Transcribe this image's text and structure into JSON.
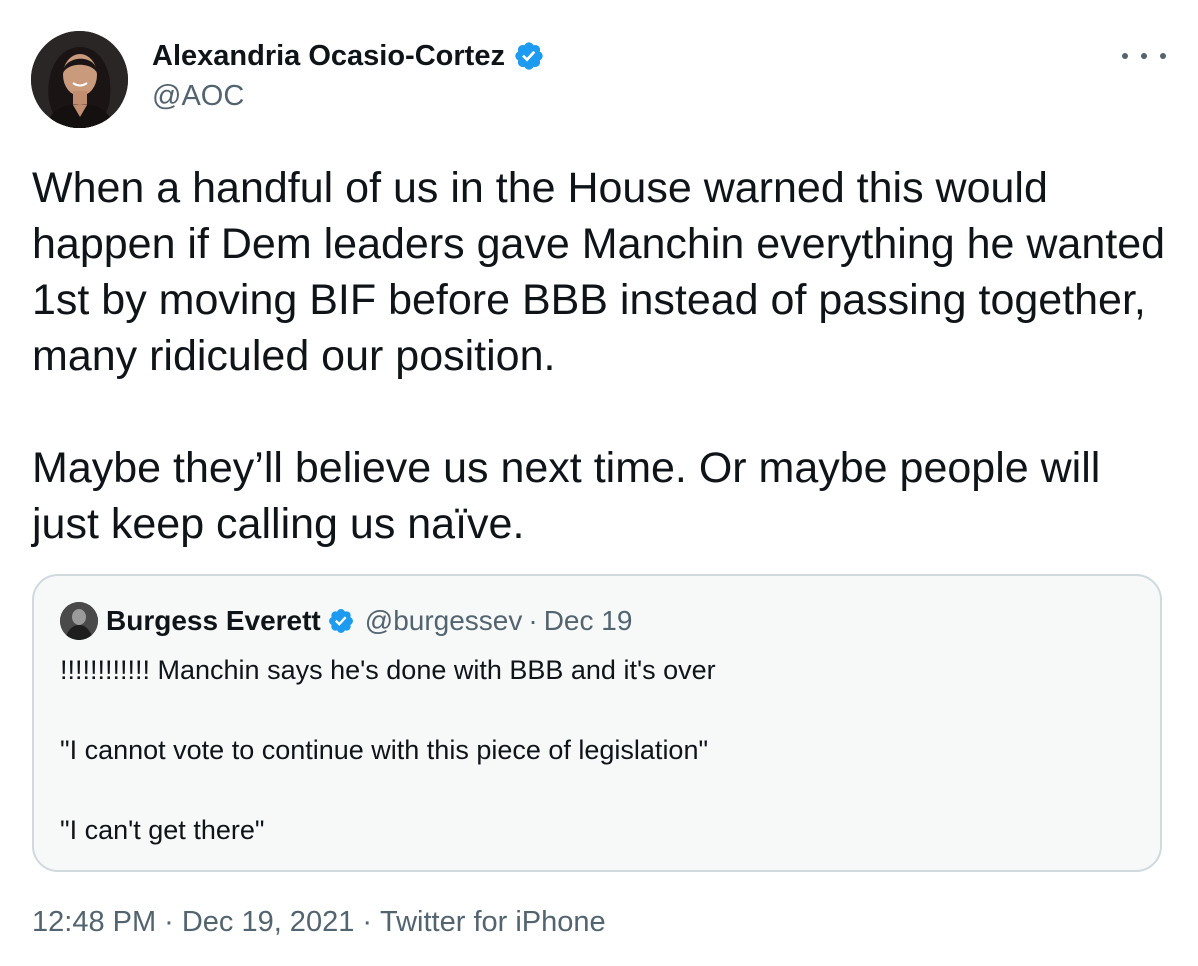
{
  "author": {
    "name": "Alexandria Ocasio-Cortez",
    "handle": "@AOC",
    "verified": true
  },
  "tweet": {
    "paragraph1": "When a handful of us in the House warned this would happen if Dem leaders gave Manchin everything he wanted 1st by moving BIF before BBB instead of passing together, many ridiculed our position.",
    "paragraph2": "Maybe they’ll believe us next time. Or maybe people will just keep calling us naïve."
  },
  "quoted": {
    "name": "Burgess Everett",
    "handle": "@burgessev",
    "separator": "·",
    "date": "Dec 19",
    "verified": true,
    "line1": "!!!!!!!!!!!! Manchin says he's done with BBB and it's over",
    "line2": "\"I cannot vote to continue with this piece of legislation\"",
    "line3": "\"I can't get there\""
  },
  "meta": {
    "time": "12:48 PM",
    "separator": "·",
    "date": "Dec 19, 2021",
    "source": "Twitter for iPhone"
  },
  "icons": {
    "verified": "verified-badge-icon",
    "more": "more-options-icon"
  },
  "colors": {
    "verified_blue": "#1d9bf0",
    "secondary_text": "#536471",
    "quote_border": "#cfd9de"
  }
}
